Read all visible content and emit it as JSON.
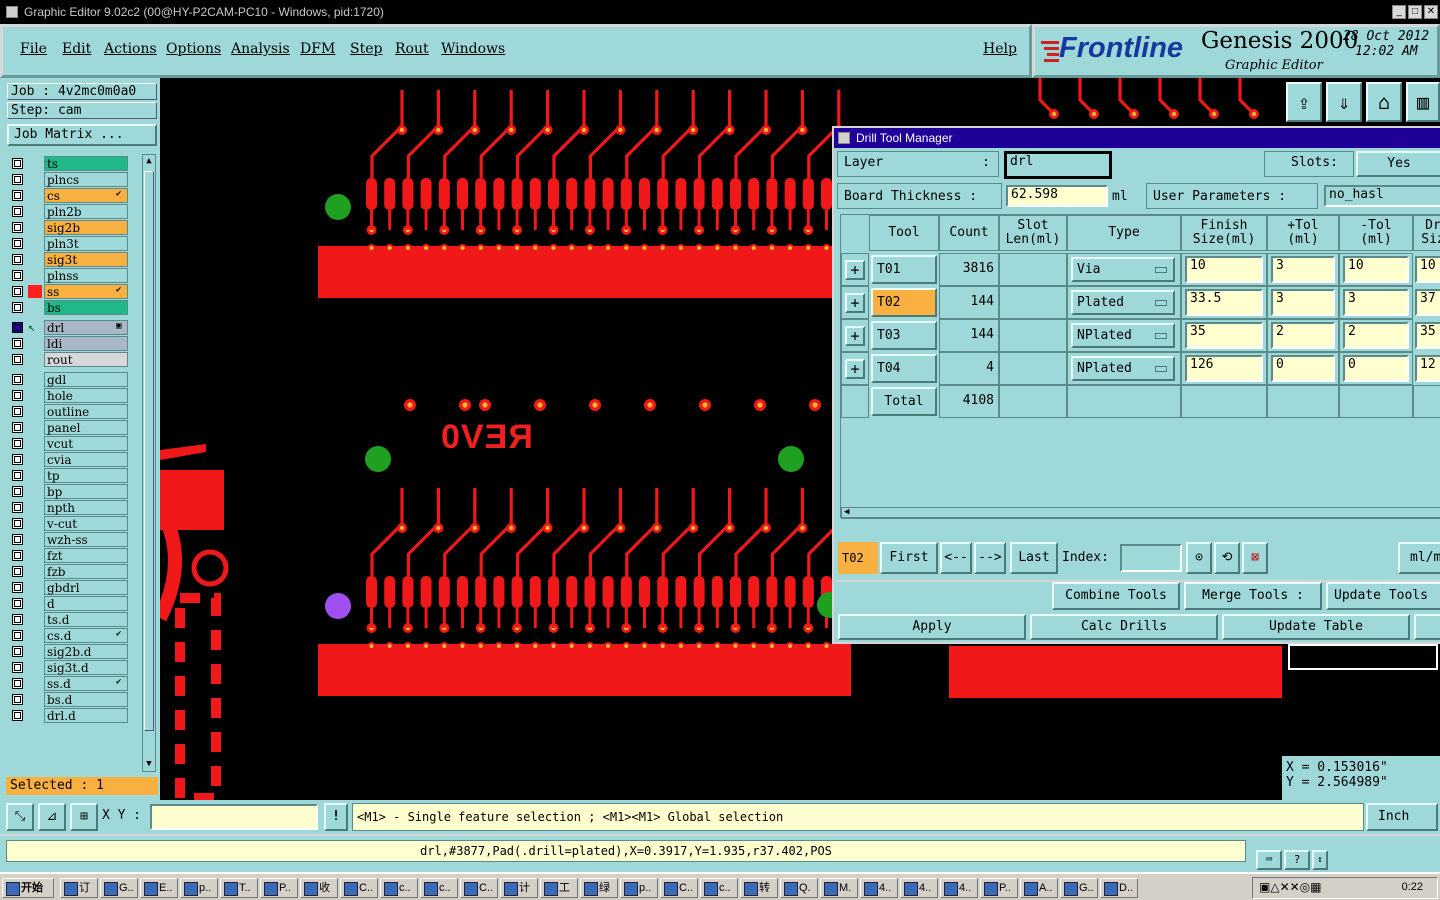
{
  "window": {
    "title": "Graphic Editor 9.02c2 (00@HY-P2CAM-PC10 - Windows, pid:1720)"
  },
  "menu": [
    "File",
    "Edit",
    "Actions",
    "Options",
    "Analysis",
    "DFM",
    "Step",
    "Rout",
    "Windows"
  ],
  "help_label": "Help",
  "brand": {
    "logo": "Frontline",
    "product": "Genesis 2000",
    "subtitle": "Graphic Editor",
    "date": "28 Oct 2012",
    "time": "12:02 AM"
  },
  "job": {
    "job_text": "Job : 4v2mc0m0a0",
    "step_text": "Step: cam",
    "matrix_label": "Job Matrix ..."
  },
  "layers": [
    {
      "name": "ts",
      "color": "#20b888"
    },
    {
      "name": "plncs",
      "color": "#9fd8d8"
    },
    {
      "name": "cs",
      "color": "#f8b040",
      "mark": "✔"
    },
    {
      "name": "pln2b",
      "color": "#9fd8d8"
    },
    {
      "name": "sig2b",
      "color": "#f8b040"
    },
    {
      "name": "pln3t",
      "color": "#9fd8d8"
    },
    {
      "name": "sig3t",
      "color": "#f8b040"
    },
    {
      "name": "plnss",
      "color": "#9fd8d8"
    },
    {
      "name": "ss",
      "color": "#f8b040",
      "mark": "✔",
      "swatch": "#ff2020"
    },
    {
      "name": "bs",
      "color": "#20b888"
    },
    {
      "name": "drl",
      "color": "#a8b8c8",
      "mark": "▣",
      "active": true
    },
    {
      "name": "ldi",
      "color": "#a8b8c8"
    },
    {
      "name": "rout",
      "color": "#d8d8d8"
    },
    {
      "name": "gdl",
      "color": "#9fd8d8"
    },
    {
      "name": "hole",
      "color": "#9fd8d8"
    },
    {
      "name": "outline",
      "color": "#9fd8d8"
    },
    {
      "name": "panel",
      "color": "#9fd8d8"
    },
    {
      "name": "vcut",
      "color": "#9fd8d8"
    },
    {
      "name": "cvia",
      "color": "#9fd8d8"
    },
    {
      "name": "tp",
      "color": "#9fd8d8"
    },
    {
      "name": "bp",
      "color": "#9fd8d8"
    },
    {
      "name": "npth",
      "color": "#9fd8d8"
    },
    {
      "name": "v-cut",
      "color": "#9fd8d8"
    },
    {
      "name": "wzh-ss",
      "color": "#9fd8d8"
    },
    {
      "name": "fzt",
      "color": "#9fd8d8"
    },
    {
      "name": "fzb",
      "color": "#9fd8d8"
    },
    {
      "name": "gbdrl",
      "color": "#9fd8d8"
    },
    {
      "name": "d",
      "color": "#9fd8d8"
    },
    {
      "name": "ts.d",
      "color": "#9fd8d8"
    },
    {
      "name": "cs.d",
      "color": "#9fd8d8",
      "mark": "✔"
    },
    {
      "name": "sig2b.d",
      "color": "#9fd8d8"
    },
    {
      "name": "sig3t.d",
      "color": "#9fd8d8"
    },
    {
      "name": "ss.d",
      "color": "#9fd8d8",
      "mark": "✔"
    },
    {
      "name": "bs.d",
      "color": "#9fd8d8"
    },
    {
      "name": "drl.d",
      "color": "#9fd8d8"
    }
  ],
  "selected_text": "Selected : 1",
  "canvas_text": {
    "rev": "REV0"
  },
  "drill_tool_manager": {
    "title": "Drill Tool Manager",
    "layer_label": "Layer",
    "layer_sep": ":",
    "layer_value": "drl",
    "slots_label": "Slots:",
    "slots_value": "Yes",
    "board_thickness_label": "Board Thickness :",
    "board_thickness_value": "62.598",
    "board_thickness_unit": "ml",
    "user_params_label": "User Parameters :",
    "user_params_value": "no_hasl",
    "headers": [
      "Tool",
      "Count",
      "Slot\nLen(ml)",
      "Type",
      "Finish\nSize(ml)",
      "+Tol\n(ml)",
      "-Tol\n(ml)",
      "Dr\nSiz"
    ],
    "rows": [
      {
        "tool": "T01",
        "count": "3816",
        "type": "Via",
        "finish": "10",
        "ptol": "3",
        "mtol": "10",
        "drill": "10"
      },
      {
        "tool": "T02",
        "count": "144",
        "type": "Plated",
        "finish": "33.5",
        "ptol": "3",
        "mtol": "3",
        "drill": "37"
      },
      {
        "tool": "T03",
        "count": "144",
        "type": "NPlated",
        "finish": "35",
        "ptol": "2",
        "mtol": "2",
        "drill": "35"
      },
      {
        "tool": "T04",
        "count": "4",
        "type": "NPlated",
        "finish": "126",
        "ptol": "0",
        "mtol": "0",
        "drill": "12"
      }
    ],
    "total_label": "Total",
    "total_count": "4108",
    "current_tool": "T02",
    "nav": {
      "first": "First",
      "prev": "<--",
      "next": "-->",
      "last": "Last",
      "index_label": "Index:",
      "units": "ml/m"
    },
    "combine_label": "Combine Tools",
    "merge_label": "Merge Tools :",
    "update_tools_label": "Update Tools",
    "apply_label": "Apply",
    "calc_label": "Calc Drills",
    "update_table_label": "Update Table"
  },
  "coords": {
    "x_text": "X = 0.153016\"",
    "y_text": "Y = 2.564989\""
  },
  "status": {
    "xy_label": "X Y :",
    "xy_value": "",
    "message": "<M1> - Single feature selection ; <M1><M1> Global selection",
    "units": "Inch",
    "info": "drl,#3877,Pad(.drill=plated),X=0.3917,Y=1.935,r37.402,POS"
  },
  "taskbar": {
    "start": "开始",
    "tasks": [
      "订",
      "G..",
      "E..",
      "p..",
      "T..",
      "P..",
      "收",
      "C..",
      "c..",
      "c..",
      "C..",
      "计",
      "工",
      "绿",
      "p..",
      "C..",
      "c..",
      "转",
      "Q.",
      "M.",
      "4..",
      "4..",
      "4..",
      "P..",
      "A..",
      "G..",
      "D.."
    ],
    "clock": "0:22"
  }
}
